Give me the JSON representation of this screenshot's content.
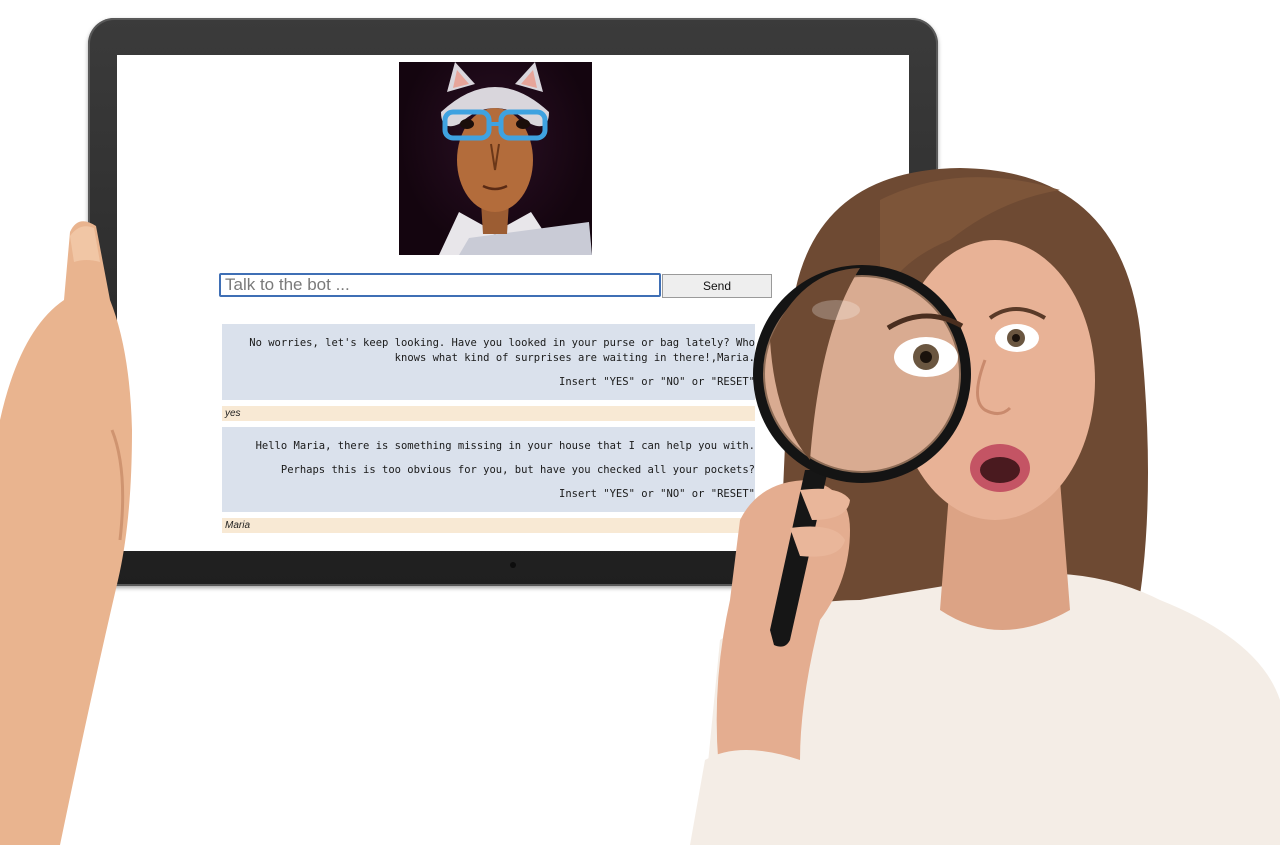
{
  "chat": {
    "input_placeholder": "Talk to the bot ...",
    "send_label": "Send",
    "messages": [
      {
        "role": "bot",
        "lines": [
          "No worries, let's keep looking. Have you looked in your purse or bag lately? Who knows what kind of surprises are waiting in there!,Maria.",
          "Insert \"YES\" or \"NO\" or \"RESET\""
        ]
      },
      {
        "role": "user",
        "text": "yes"
      },
      {
        "role": "bot",
        "lines": [
          "Hello Maria, there is something missing in your house that I can help you with.",
          "Perhaps this is too obvious for you, but have you checked all your pockets?",
          "Insert \"YES\" or \"NO\" or \"RESET\""
        ]
      },
      {
        "role": "user",
        "text": "Maria"
      }
    ]
  },
  "colors": {
    "bot_bubble": "#dae1ec",
    "user_bubble": "#f8e9d4",
    "input_border": "#3f6fb5",
    "tablet_frame": "#2b2b2b"
  },
  "icons": {
    "bot_avatar": "cat-scientist-avatar",
    "magnifier": "magnifying-glass"
  }
}
